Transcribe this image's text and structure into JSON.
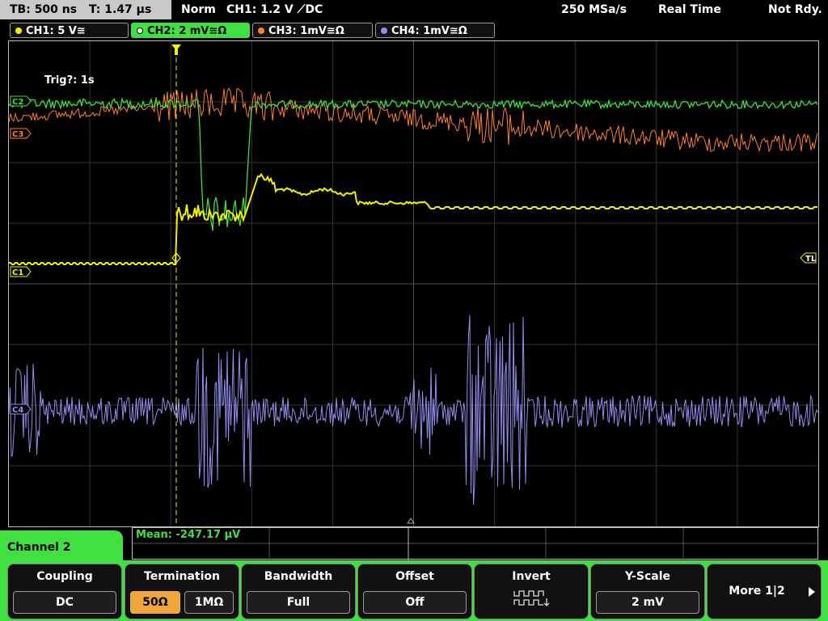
{
  "status_bar": {
    "timebase": "TB: 500 ns",
    "trigger_time": "T: 1.47 µs",
    "mode": "Norm",
    "trigger": "CH1: 1.2 V ⟋DC",
    "sample_rate": "250 MSa/s",
    "acquisition": "Real Time",
    "state": "Not Rdy."
  },
  "channels": [
    {
      "label": "CH1: 5 V≅",
      "color": "#f0f000"
    },
    {
      "label": "CH2: 2 mV≅Ω",
      "color": "#3fe03f"
    },
    {
      "label": "CH3: 1mV≅Ω",
      "color": "#ff7f2a"
    },
    {
      "label": "CH4: 1mV≅Ω",
      "color": "#8f8fef"
    }
  ],
  "screen": {
    "trig_text": "Trig?: 1s",
    "marker_c1": "C1",
    "marker_c2": "C2",
    "marker_c3": "C3",
    "marker_c4": "C4",
    "marker_tl": "TL"
  },
  "measurement": {
    "text": "Mean: -247.17 µV"
  },
  "menu": {
    "title": "Channel 2",
    "softkeys": {
      "coupling": {
        "title": "Coupling",
        "value": "DC"
      },
      "termination": {
        "title": "Termination",
        "options": [
          "50Ω",
          "1MΩ"
        ],
        "selected": "50Ω"
      },
      "bandwidth": {
        "title": "Bandwidth",
        "value": "Full"
      },
      "offset": {
        "title": "Offset",
        "value": "Off"
      },
      "invert": {
        "title": "Invert",
        "icon": "invert-waveform-icon"
      },
      "yscale": {
        "title": "Y-Scale",
        "value": "2 mV"
      },
      "more": {
        "label": "More 1|2",
        "icon": "right-arrow-icon"
      }
    }
  }
}
